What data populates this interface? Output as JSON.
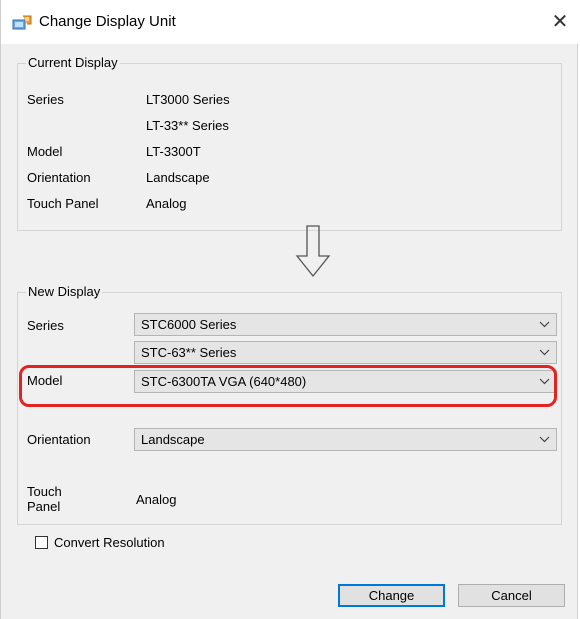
{
  "window": {
    "title": "Change Display Unit",
    "close_glyph": "✕"
  },
  "current": {
    "legend": "Current Display",
    "series_label": "Series",
    "series_value": "LT3000 Series",
    "series_sub_value": "LT-33** Series",
    "model_label": "Model",
    "model_value": "LT-3300T",
    "orientation_label": "Orientation",
    "orientation_value": "Landscape",
    "touch_label": "Touch Panel",
    "touch_value": "Analog"
  },
  "new": {
    "legend": "New Display",
    "series_label": "Series",
    "series_value": "STC6000 Series",
    "series_sub_value": "STC-63** Series",
    "model_label": "Model",
    "model_value": "STC-6300TA VGA (640*480)",
    "orientation_label": "Orientation",
    "orientation_value": "Landscape",
    "touch_label_line1": "Touch",
    "touch_label_line2": "Panel",
    "touch_value": "Analog"
  },
  "convert_resolution": {
    "label": "Convert Resolution",
    "checked": false
  },
  "buttons": {
    "change": "Change",
    "cancel": "Cancel"
  },
  "colors": {
    "highlight": "#e32222",
    "focus_border": "#0078d7",
    "dialog_bg": "#f0f0f0"
  },
  "icons": {
    "title": "display-unit-icon",
    "arrow": "down-arrow-icon",
    "chevron": "chevron-down-icon"
  }
}
